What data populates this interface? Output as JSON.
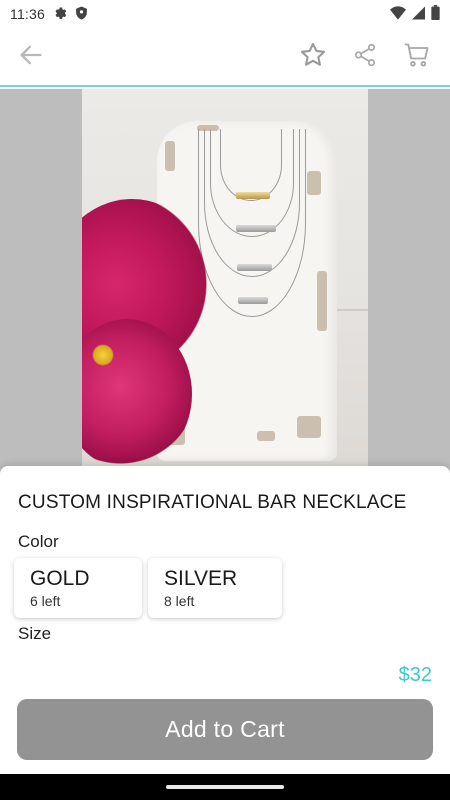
{
  "status_bar": {
    "time": "11:36",
    "icons_left": [
      "gear-icon",
      "shield-icon"
    ],
    "icons_right": [
      "wifi-icon",
      "signal-icon",
      "battery-icon"
    ]
  },
  "app_bar": {
    "icons": [
      "back-arrow-icon",
      "star-icon",
      "share-icon",
      "cart-icon"
    ],
    "accent_color": "#79d3d3"
  },
  "product": {
    "title": "CUSTOM INSPIRATIONAL BAR NECKLACE",
    "image_name": "product-photo"
  },
  "options": {
    "color_label": "Color",
    "colors": [
      {
        "name": "GOLD",
        "stock": "6 left"
      },
      {
        "name": "SILVER",
        "stock": "8 left"
      }
    ],
    "size_label": "Size"
  },
  "footer": {
    "price": "$32",
    "price_color": "#3fc9c9",
    "add_to_cart_label": "Add to Cart",
    "button_color": "#939393"
  }
}
